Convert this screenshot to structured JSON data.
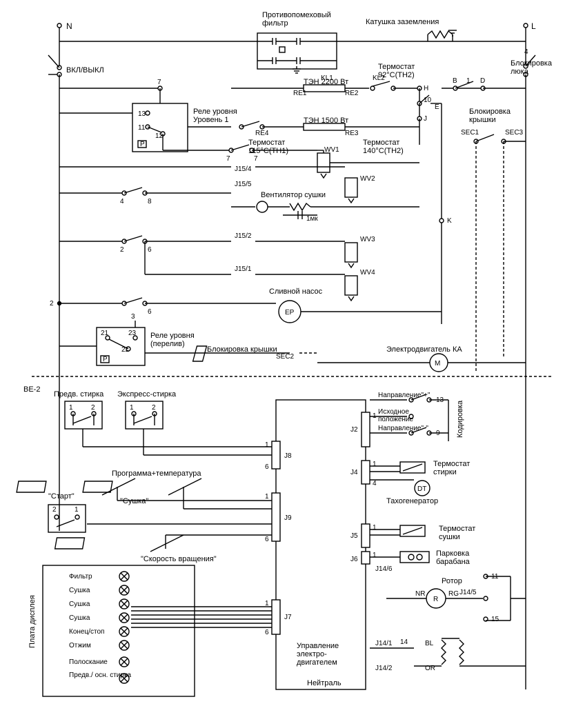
{
  "terminals": {
    "N": "N",
    "L": "L"
  },
  "onoff": "ВКЛ/ВЫКЛ",
  "filter": "Противопомеховый\nфильтр",
  "ground_coil": "Катушка заземления",
  "door_lock": "Блокировка\nлюка",
  "lid_lock_right": "Блокировка\nкрышки",
  "level_relay1": "Реле уровня\nУровень 1",
  "level_relay2": "Реле уровня\n(перелив)",
  "heater1": "ТЭН 2200 Вт",
  "heater2": "ТЭН 1500 Вт",
  "thermostat92": "Термостат\n92°C(TH2)",
  "thermostat115": "Термостат\n115°C(TH1)",
  "thermostat140": "Термостат\n140°C(TH2)",
  "fan": "Вентилятор сушки",
  "cap": "1мк",
  "drain": "Сливной насос",
  "ep": "EP",
  "lid_lock2": "Блокировка крышки",
  "motorKA": "Электродвигатель КА",
  "be2": "BE-2",
  "prewash": "Предв. стирка",
  "express": "Экспресс-стирка",
  "start": "\"Старт\"",
  "prog_temp": "Программа+температура",
  "drying": "\"Сушка\"",
  "speed": "\"Скорость вращения\"",
  "display_panel": "Плата дисплея",
  "leds": [
    "Фильтр",
    "Сушка",
    "Сушка",
    "Сушка",
    "Конец/стоп",
    "Отжим",
    "Полоскание",
    "Предв./ осн.\nстирка"
  ],
  "direction_plus": "Направление\"+\"",
  "home_pos": "Исходное\nположение",
  "direction_minus": "Направление\"-\"",
  "coding": "Кодировка",
  "wash_thermo": "Термостат\nстирки",
  "tacho": "Тахогенератор",
  "dry_thermo": "Термостат\nсушки",
  "drum_park": "Парковка\nбарабана",
  "rotor": "Ротор",
  "motor_ctrl": "Управление\nэлектро-\nдвигателем",
  "neutral": "Нейтраль",
  "pins": {
    "p7": "7",
    "p13": "13",
    "p11": "11",
    "p12": "12",
    "p21": "21",
    "p22": "22",
    "p23": "23",
    "p3": "3",
    "p6": "6",
    "p2": "2",
    "p4": "4",
    "p10": "10",
    "H": "H",
    "J": "J",
    "E": "E",
    "K": "K",
    "B": "B",
    "D": "D",
    "P": "P",
    "RE1": "RE1",
    "RE2": "RE2",
    "RE3": "RE3",
    "RE4": "RE4",
    "KL1": "KL1",
    "KL2": "KL2",
    "WV1": "WV1",
    "WV2": "WV2",
    "WV3": "WV3",
    "WV4": "WV4",
    "SEC1": "SEC1",
    "SEC2": "SEC2",
    "SEC3": "SEC3",
    "J2": "J2",
    "J4": "J4",
    "J5": "J5",
    "J6": "J6",
    "J7": "J7",
    "J8": "J8",
    "J9": "J9",
    "J151": "J15/1",
    "J152": "J15/2",
    "J154": "J15/4",
    "J155": "J15/5",
    "J146": "J14/6",
    "J145": "J14/5",
    "J141": "J14/1",
    "J142": "J14/2",
    "DT": "DT",
    "R": "R",
    "NR": "NR",
    "RG": "RG",
    "BL": "BL",
    "OR": "OR",
    "M": "M",
    "n1": "1",
    "n2": "2",
    "n4": "4",
    "n6": "6",
    "n8": "8",
    "n9": "9",
    "n11": "11",
    "n13": "13",
    "n14": "14",
    "n15": "15"
  }
}
